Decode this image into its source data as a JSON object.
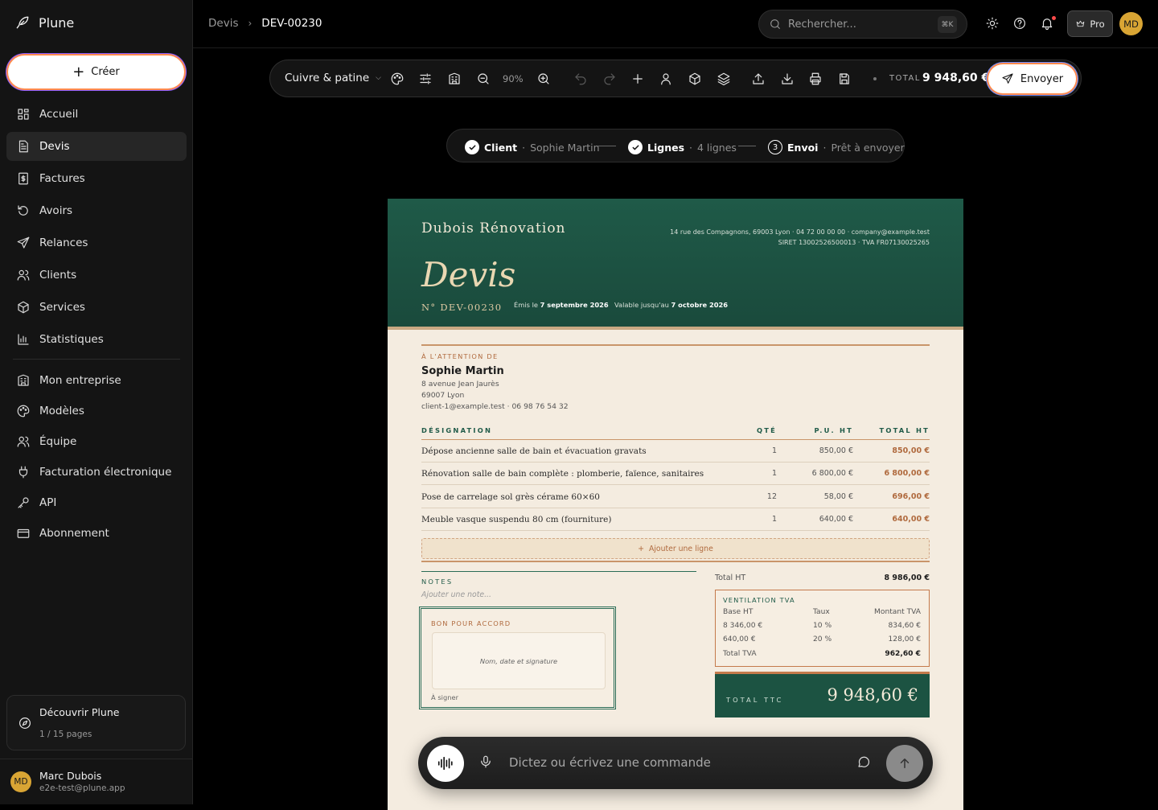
{
  "app": {
    "name": "Plune"
  },
  "sidebar": {
    "create_label": "Créer",
    "items": [
      {
        "label": "Accueil",
        "icon": "dashboard-icon"
      },
      {
        "label": "Devis",
        "icon": "document-icon",
        "active": true
      },
      {
        "label": "Factures",
        "icon": "invoice-icon"
      },
      {
        "label": "Avoirs",
        "icon": "rotate-ccw-icon"
      },
      {
        "label": "Relances",
        "icon": "send-icon"
      },
      {
        "label": "Clients",
        "icon": "users-icon"
      },
      {
        "label": "Services",
        "icon": "box-icon"
      },
      {
        "label": "Statistiques",
        "icon": "bar-chart-icon"
      }
    ],
    "settings_items": [
      {
        "label": "Mon entreprise",
        "icon": "building-icon"
      },
      {
        "label": "Modèles",
        "icon": "palette-icon"
      },
      {
        "label": "Équipe",
        "icon": "team-icon"
      },
      {
        "label": "Facturation électronique",
        "icon": "plug-icon"
      },
      {
        "label": "API",
        "icon": "key-icon"
      },
      {
        "label": "Abonnement",
        "icon": "card-icon"
      }
    ],
    "discover": {
      "title": "Découvrir Plune",
      "progress": "1 / 15 pages"
    },
    "user": {
      "initials": "MD",
      "name": "Marc Dubois",
      "email": "e2e-test@plune.app"
    }
  },
  "header": {
    "breadcrumb": [
      "Devis",
      "DEV-00230"
    ],
    "search_placeholder": "Rechercher...",
    "search_shortcut": "⌘K",
    "plan_label": "Pro",
    "avatar_initials": "MD"
  },
  "toolbar": {
    "theme": "Cuivre & patine",
    "zoom": "90%",
    "total_label": "TOTAL",
    "total_value": "9 948,60 €",
    "send_label": "Envoyer"
  },
  "stepper": [
    {
      "label": "Client",
      "detail": "Sophie Martin",
      "state": "done"
    },
    {
      "label": "Lignes",
      "detail": "4 lignes",
      "state": "done"
    },
    {
      "label": "Envoi",
      "detail": "Prêt à envoyer",
      "state": "current",
      "number": "3"
    }
  ],
  "document": {
    "company": "Dubois Rénovation",
    "company_address": "14 rue des Compagnons, 69003 Lyon · 04 72 00 00 00 · company@example.test",
    "company_ids": "SIRET 13002526500013 · TVA FR07130025265",
    "title": "Devis",
    "number": "N° DEV-00230",
    "issued_prefix": "Émis le",
    "issued_date": "7 septembre 2026",
    "valid_prefix": "Valable jusqu'au",
    "valid_date": "7 octobre 2026",
    "attention_label": "À L'ATTENTION DE",
    "client": {
      "name": "Sophie Martin",
      "lines": [
        "8 avenue Jean Jaurès",
        "69007 Lyon",
        "client-1@example.test · 06 98 76 54 32"
      ]
    },
    "columns": [
      "DÉSIGNATION",
      "QTÉ",
      "P.U. HT",
      "TOTAL HT"
    ],
    "rows": [
      {
        "designation": "Dépose ancienne salle de bain et évacuation gravats",
        "qty": "1",
        "unit": "850,00 €",
        "total": "850,00 €"
      },
      {
        "designation": "Rénovation salle de bain complète : plomberie, faïence, sanitaires",
        "qty": "1",
        "unit": "6 800,00 €",
        "total": "6 800,00 €"
      },
      {
        "designation": "Pose de carrelage sol grès cérame 60×60",
        "qty": "12",
        "unit": "58,00 €",
        "total": "696,00 €"
      },
      {
        "designation": "Meuble vasque suspendu 80 cm (fourniture)",
        "qty": "1",
        "unit": "640,00 €",
        "total": "640,00 €"
      }
    ],
    "add_line_label": "Ajouter une ligne",
    "notes_label": "NOTES",
    "notes_placeholder": "Ajouter une note...",
    "signature": {
      "label": "BON POUR ACCORD",
      "placeholder": "Nom, date et signature",
      "status": "À signer"
    },
    "total_ht_label": "Total HT",
    "total_ht_value": "8 986,00 €",
    "vat": {
      "label": "VENTILATION TVA",
      "headers": [
        "Base HT",
        "Taux",
        "Montant TVA"
      ],
      "rows": [
        {
          "base": "8 346,00 €",
          "rate": "10 %",
          "amount": "834,60 €"
        },
        {
          "base": "640,00 €",
          "rate": "20 %",
          "amount": "128,00 €"
        }
      ],
      "total_label": "Total TVA",
      "total_value": "962,60 €"
    },
    "ttc_label": "TOTAL TTC",
    "ttc_value": "9 948,60 €"
  },
  "command_bar": {
    "placeholder": "Dictez ou écrivez une commande"
  }
}
